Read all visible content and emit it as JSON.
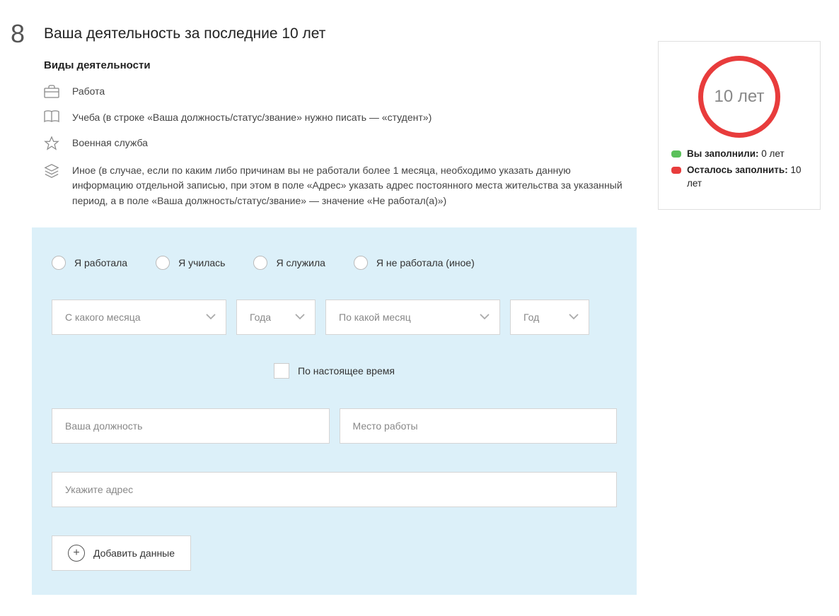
{
  "step": "8",
  "title": "Ваша деятельность за последние 10 лет",
  "subtitle": "Виды деятельности",
  "activities": {
    "work": "Работа",
    "study": "Учеба (в строке «Ваша должность/статус/звание» нужно писать — «студент»)",
    "military": "Военная служба",
    "other": "Иное (в случае, если по каким либо причинам вы не работали более 1 месяца, необходимо указать данную информацию отдельной записью, при этом в поле «Адрес» указать адрес постоянного места жительства за указанный период, а в поле «Ваша должность/статус/звание» — значение «Не работал(а)»)"
  },
  "radios": {
    "worked": "Я работала",
    "studied": "Я училась",
    "served": "Я служила",
    "none": "Я не работала (иное)"
  },
  "selects": {
    "from_month": "С какого месяца",
    "from_year": "Года",
    "to_month": "По какой месяц",
    "to_year": "Год"
  },
  "checkbox": {
    "present": "По настоящее время"
  },
  "inputs": {
    "position": "Ваша должность",
    "workplace": "Место работы",
    "address": "Укажите адрес"
  },
  "buttons": {
    "add": "Добавить данные"
  },
  "progress": {
    "circle_label": "10 лет",
    "filled_label": "Вы заполнили:",
    "filled_value": " 0 лет",
    "remaining_label": "Осталось заполнить:",
    "remaining_value": " 10 лет"
  }
}
